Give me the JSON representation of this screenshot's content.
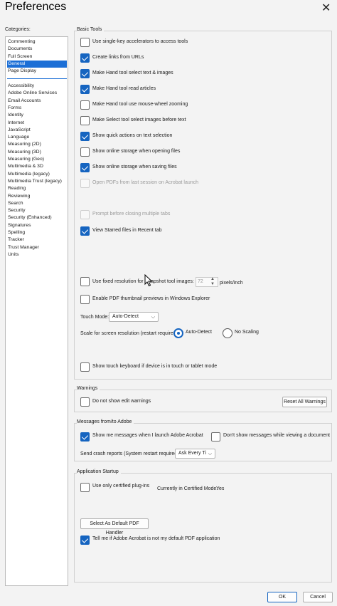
{
  "window": {
    "title": "Preferences",
    "close_glyph": "✕"
  },
  "categories": {
    "label": "Categories:",
    "top_group": [
      "Commenting",
      "Documents",
      "Full Screen",
      "General",
      "Page Display"
    ],
    "selected": "General",
    "bottom_group": [
      "Accessibility",
      "Adobe Online Services",
      "Email Accounts",
      "Forms",
      "Identity",
      "Internet",
      "JavaScript",
      "Language",
      "Measuring (2D)",
      "Measuring (3D)",
      "Measuring (Geo)",
      "Multimedia & 3D",
      "Multimedia (legacy)",
      "Multimedia Trust (legacy)",
      "Reading",
      "Reviewing",
      "Search",
      "Security",
      "Security (Enhanced)",
      "Signatures",
      "Spelling",
      "Tracker",
      "Trust Manager",
      "Units"
    ]
  },
  "basic_tools": {
    "title": "Basic Tools",
    "options": [
      {
        "label": "Use single-key accelerators to access tools",
        "checked": false,
        "disabled": false
      },
      {
        "label": "Create links from URLs",
        "checked": true,
        "disabled": false
      },
      {
        "label": "Make Hand tool select text & images",
        "checked": true,
        "disabled": false
      },
      {
        "label": "Make Hand tool read articles",
        "checked": true,
        "disabled": false
      },
      {
        "label": "Make Hand tool use mouse-wheel zooming",
        "checked": false,
        "disabled": false
      },
      {
        "label": "Make Select tool select images before text",
        "checked": false,
        "disabled": false
      },
      {
        "label": "Show quick actions on text selection",
        "checked": true,
        "disabled": false
      },
      {
        "label": "Show online storage when opening files",
        "checked": false,
        "disabled": false
      },
      {
        "label": "Show online storage when saving files",
        "checked": true,
        "disabled": false
      },
      {
        "label": "Open PDFs from last session on Acrobat launch",
        "checked": false,
        "disabled": true
      },
      {
        "label": "Prompt before closing multiple tabs",
        "checked": false,
        "disabled": true
      },
      {
        "label": "View Starred files in Recent tab",
        "checked": true,
        "disabled": false
      }
    ],
    "fixed_resolution": {
      "label": "Use fixed resolution for Snapshot tool images:",
      "value": "72",
      "unit": "pixels/inch",
      "checked": false
    },
    "thumbnail": {
      "label": "Enable PDF thumbnail previews in Windows Explorer",
      "checked": false
    },
    "touch_mode": {
      "label": "Touch Mode:",
      "value": "Auto-Detect"
    },
    "scale": {
      "label": "Scale for screen resolution (restart required):",
      "options": [
        "Auto-Detect",
        "No Scaling"
      ],
      "selected": "Auto-Detect"
    },
    "touch_keyboard": {
      "label": "Show touch keyboard if device is in touch or tablet mode",
      "checked": false
    }
  },
  "warnings": {
    "title": "Warnings",
    "do_not_show": {
      "label": "Do not show edit warnings",
      "checked": false
    },
    "reset_button": "Reset All Warnings"
  },
  "messages": {
    "title": "Messages from/to Adobe",
    "show_launch": {
      "label": "Show me messages when I launch Adobe Acrobat",
      "checked": true
    },
    "dont_show_viewing": {
      "label": "Don't show messages while viewing a document",
      "checked": false
    },
    "crash_label": "Send crash reports (System restart required):",
    "crash_value": "Ask Every Ti"
  },
  "startup": {
    "title": "Application Startup",
    "certified": {
      "label": "Use only certified plug-ins",
      "checked": false
    },
    "certified_mode_label": "Currently in Certified Mode:",
    "certified_mode_value": "Yes",
    "default_button": "Select As Default PDF Handler",
    "tell_me": {
      "label": "Tell me if Adobe Acrobat is not my default PDF application",
      "checked": true
    }
  },
  "footer": {
    "ok": "OK",
    "cancel": "Cancel"
  }
}
